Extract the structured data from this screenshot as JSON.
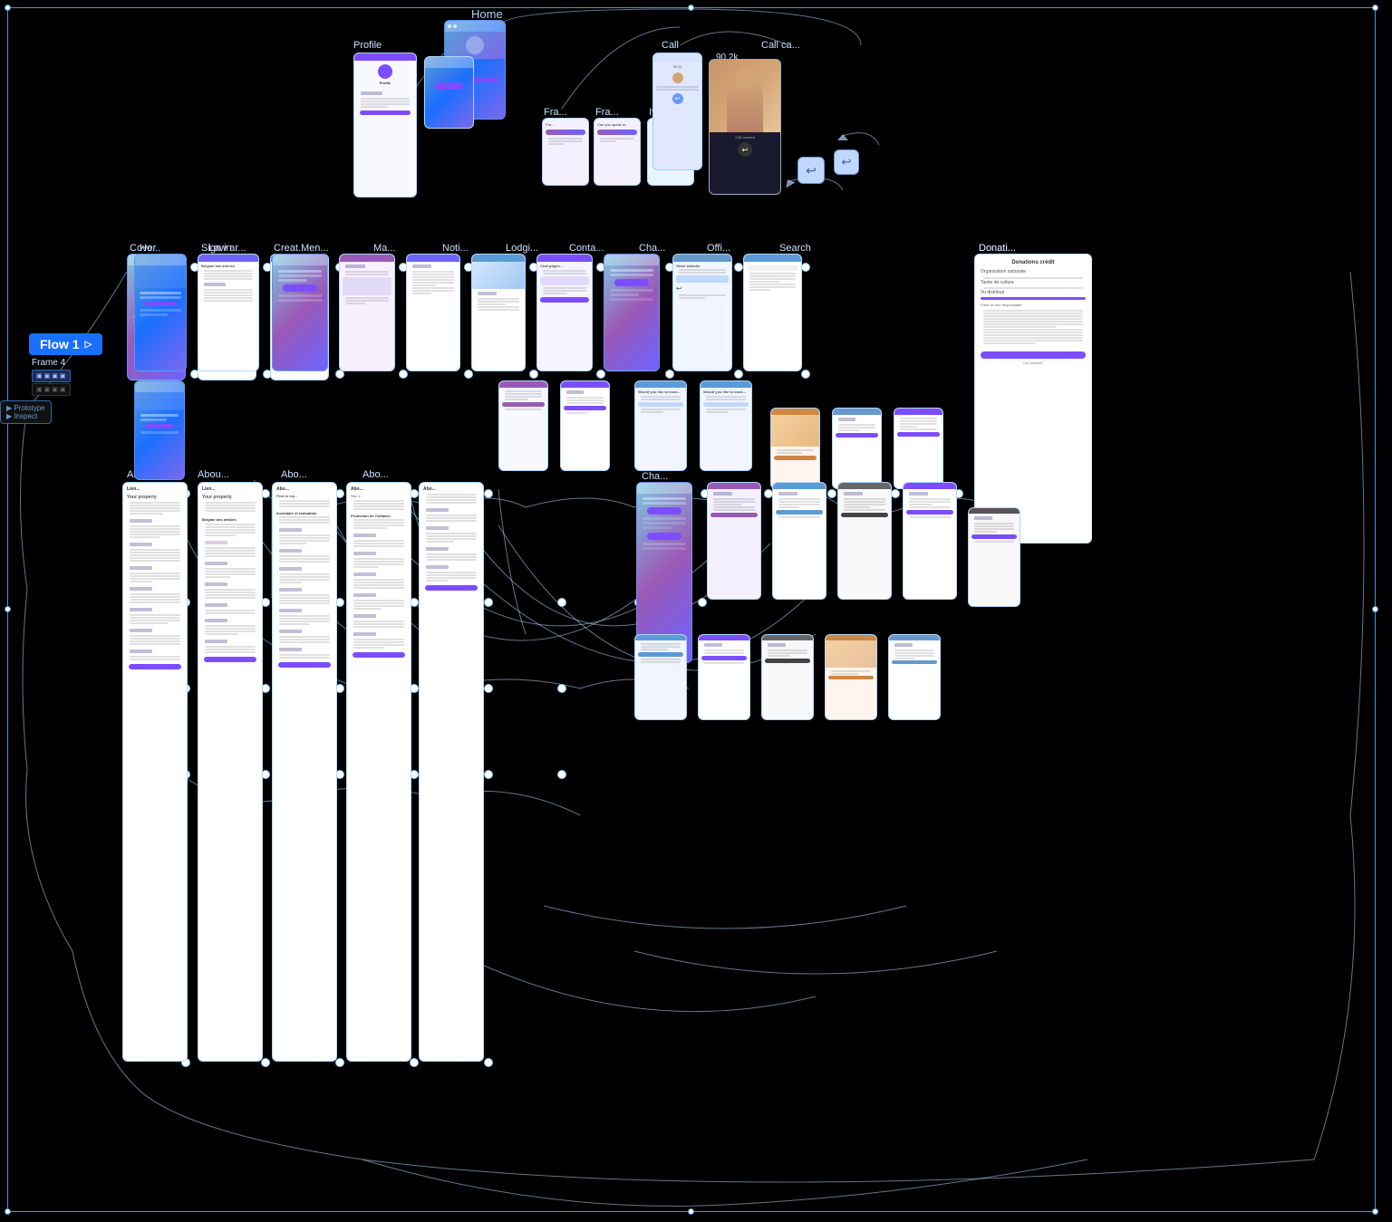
{
  "canvas": {
    "bg": "#000",
    "border_color": "#4a90d9"
  },
  "flow": {
    "label": "Flow 1",
    "icon": "▷"
  },
  "frames": {
    "top_row": [
      "Home",
      "Profile",
      "Call",
      "Call ca..."
    ],
    "second_row": [
      "Cover",
      "Sign in",
      "Creat...",
      "Fra...",
      "Fra...",
      "Iv...",
      ""
    ],
    "third_row": [
      "Ho...",
      "Law ar...",
      "Men...",
      "Ma...",
      "Noti...",
      "Lodgi...",
      "Conta...",
      "Cha...",
      "Offi...",
      "Search",
      "Donati..."
    ],
    "about_row": [
      "Abou...",
      "Abou...",
      "Abo...",
      "Abo..."
    ],
    "bottom_extras": [
      "Frame 4"
    ]
  },
  "sidebar": {
    "items": [
      {
        "label": "Frame 4",
        "active": true
      },
      {
        "label": "▣ ▣ ▣",
        "active": false
      },
      {
        "label": "▣ ▣ ▣",
        "active": false
      }
    ]
  },
  "connections": {
    "color": "rgba(180,210,255,0.6)",
    "stroke_width": 1
  }
}
